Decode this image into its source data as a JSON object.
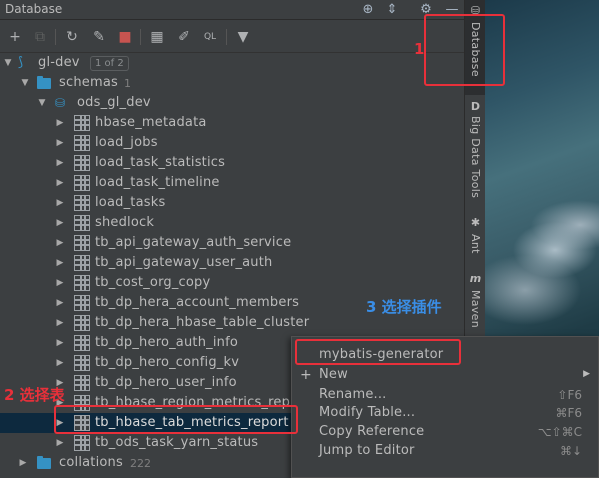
{
  "window": {
    "title": "Database"
  },
  "tree": {
    "root": {
      "label": "gl-dev",
      "badge": "1 of 2"
    },
    "schemas": {
      "label": "schemas",
      "count": "1"
    },
    "schema": {
      "label": "ods_gl_dev"
    },
    "tables": [
      "hbase_metadata",
      "load_jobs",
      "load_task_statistics",
      "load_task_timeline",
      "load_tasks",
      "shedlock",
      "tb_api_gateway_auth_service",
      "tb_api_gateway_user_auth",
      "tb_cost_org_copy",
      "tb_dp_hera_account_members",
      "tb_dp_hera_hbase_table_cluster",
      "tb_dp_hero_auth_info",
      "tb_dp_hero_config_kv",
      "tb_dp_hero_user_info",
      "tb_hbase_region_metrics_rep",
      "tb_hbase_tab_metrics_report",
      "tb_ods_task_yarn_status"
    ],
    "collations": {
      "label": "collations",
      "count": "222"
    }
  },
  "tool_strip": {
    "tabs": [
      "Database",
      "Big Data Tools",
      "Ant",
      "Maven"
    ]
  },
  "context_menu": {
    "items": [
      {
        "label": "mybatis-generator",
        "shortcut": ""
      },
      {
        "label": "New",
        "shortcut": ""
      },
      {
        "label": "Rename...",
        "shortcut": "⇧F6"
      },
      {
        "label": "Modify Table...",
        "shortcut": "⌘F6"
      },
      {
        "label": "Copy Reference",
        "shortcut": "⌥⇧⌘C"
      },
      {
        "label": "Jump to Editor",
        "shortcut": "⌘↓"
      }
    ]
  },
  "annotations": {
    "step1": "1",
    "step2": "2 选择表",
    "step3": "3 选择插件"
  },
  "colors": {
    "panel_bg": "#3c3f41",
    "selection_bg": "#0d293e",
    "annotation_red": "#e8303a",
    "annotation_blue": "#3a8ee6",
    "folder_blue": "#3592c4"
  }
}
